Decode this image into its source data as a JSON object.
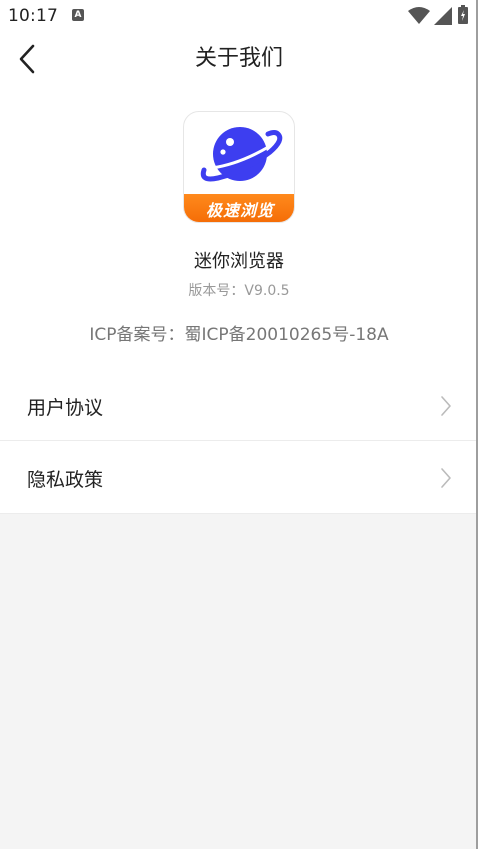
{
  "status_bar": {
    "time": "10:17",
    "notification_icon": "A"
  },
  "header": {
    "title": "关于我们",
    "back_icon": "chevron-left-icon"
  },
  "app": {
    "logo_text": "极速浏览",
    "name": "迷你浏览器",
    "version": "版本号：V9.0.5",
    "icp": "ICP备案号：蜀ICP备20010265号-18A",
    "brand_colors": {
      "planet": "#3d3ef0",
      "banner": "#f97a10"
    }
  },
  "menu": {
    "items": [
      {
        "label": "用户协议",
        "icon": "chevron-right-icon"
      },
      {
        "label": "隐私政策",
        "icon": "chevron-right-icon"
      }
    ]
  }
}
